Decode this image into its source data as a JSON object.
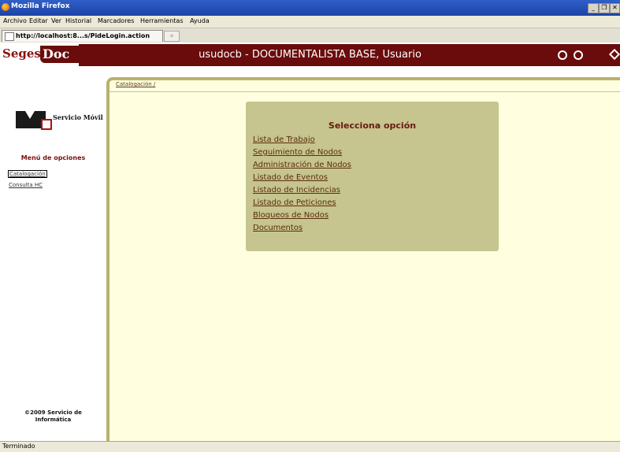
{
  "window": {
    "title": "Mozilla Firefox",
    "controls": [
      "_",
      "❐",
      "✕"
    ]
  },
  "menubar": [
    "Archivo",
    "Editar",
    "Ver",
    "Historial",
    "Marcadores",
    "Herramientas",
    "Ayuda"
  ],
  "tab": {
    "label": "http://localhost:8...s/PideLogin.action",
    "new_tab": "+"
  },
  "header": {
    "logo_seges": "Seges",
    "logo_doc": "Doc",
    "user": "usudocb - DOCUMENTALISTA BASE, Usuario",
    "icons": [
      "print-icon",
      "person-icon",
      "exit-icon"
    ],
    "brand_color": "#6a0c0c"
  },
  "sidebar": {
    "company": "Servicio Móvil",
    "menu_title": "Menú de opciones",
    "items": [
      "Catalogación",
      "Consulta HC"
    ],
    "footer_line1": "©2009 Servicio de",
    "footer_line2": "Informática"
  },
  "content": {
    "breadcrumb": "Catalogación /",
    "options_title": "Selecciona opción",
    "options": [
      "Lista de Trabajo",
      "Seguimiento de Nodos",
      "Administración de Nodos",
      "Listado de Eventos",
      "Listado de Incidencias",
      "Listado de Peticiones",
      "Bloqueos de Nodos",
      "Documentos"
    ],
    "background_color": "#ffffe0",
    "box_color": "#c6c48f"
  },
  "statusbar": {
    "text": "Terminado"
  }
}
